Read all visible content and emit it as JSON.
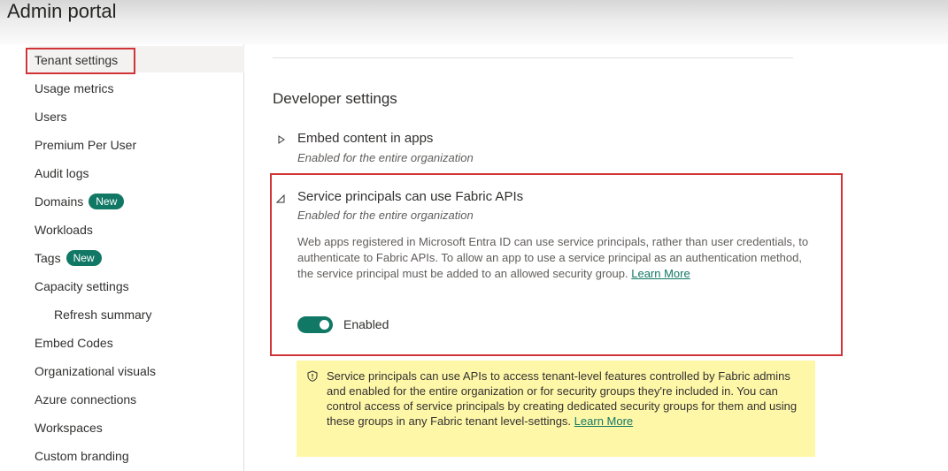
{
  "header": {
    "title": "Admin portal"
  },
  "sidebar": {
    "items": [
      {
        "label": "Tenant settings",
        "selected": true
      },
      {
        "label": "Usage metrics"
      },
      {
        "label": "Users"
      },
      {
        "label": "Premium Per User"
      },
      {
        "label": "Audit logs"
      },
      {
        "label": "Domains",
        "badge": "New"
      },
      {
        "label": "Workloads"
      },
      {
        "label": "Tags",
        "badge": "New"
      },
      {
        "label": "Capacity settings"
      },
      {
        "label": "Refresh summary",
        "indent": true
      },
      {
        "label": "Embed Codes"
      },
      {
        "label": "Organizational visuals"
      },
      {
        "label": "Azure connections"
      },
      {
        "label": "Workspaces"
      },
      {
        "label": "Custom branding"
      }
    ]
  },
  "main": {
    "section_title": "Developer settings",
    "settings": [
      {
        "title": "Embed content in apps",
        "subtitle": "Enabled for the entire organization",
        "expanded": false
      },
      {
        "title": "Service principals can use Fabric APIs",
        "subtitle": "Enabled for the entire organization",
        "expanded": true,
        "description": "Web apps registered in Microsoft Entra ID can use service principals, rather than user credentials, to authenticate to Fabric APIs. To allow an app to use a service principal as an authentication method, the service principal must be added to an allowed security group.",
        "learn_more": "Learn More",
        "toggle_label": "Enabled",
        "toggle_on": true
      }
    ],
    "notice": {
      "text": "Service principals can use APIs to access tenant-level features controlled by Fabric admins and enabled for the entire organization or for security groups they're included in. You can control access of service principals by creating dedicated security groups for them and using these groups in any Fabric tenant level-settings.",
      "learn_more": "Learn More"
    }
  },
  "colors": {
    "accent": "#117865",
    "highlight_border": "#d13438",
    "notice_bg": "#fff7a8"
  }
}
